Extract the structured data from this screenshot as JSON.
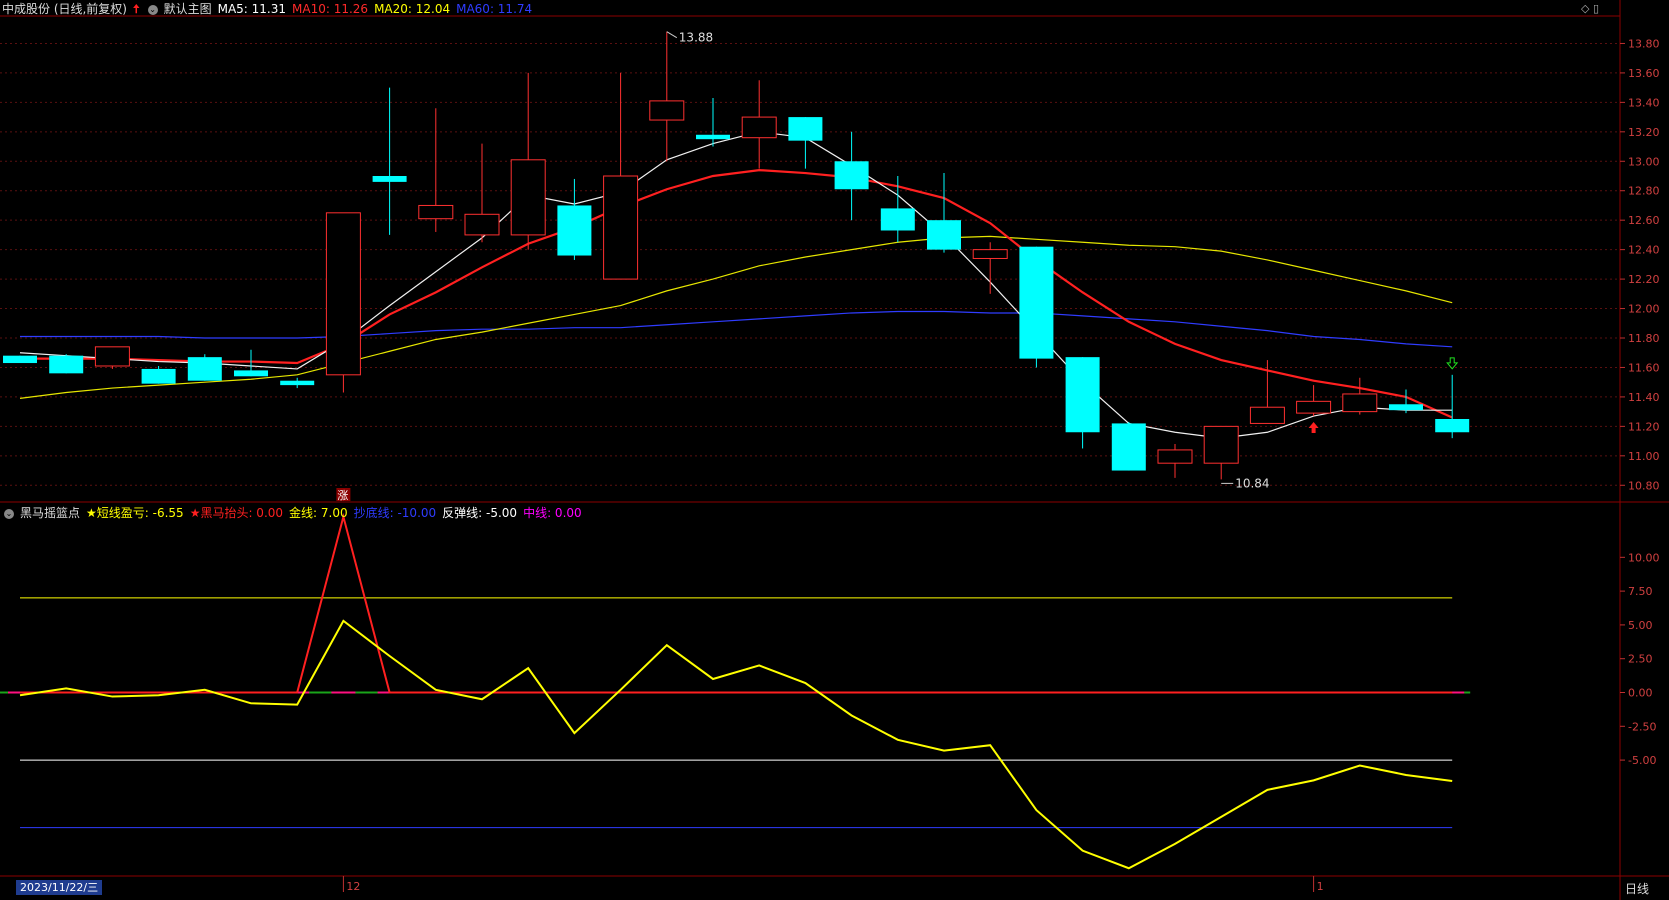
{
  "upper_header": {
    "stock": "中成股份 (日线,前复权)",
    "up_arrow_icon": "red-up-arrow-icon",
    "template": "默认主图",
    "ma_items": [
      {
        "label": "MA5: 11.31",
        "color": "#ffffff"
      },
      {
        "label": "MA10: 11.26",
        "color": "#ff2a2a"
      },
      {
        "label": "MA20: 12.04",
        "color": "#ffff00"
      },
      {
        "label": "MA60: 11.74",
        "color": "#2f3cff"
      }
    ]
  },
  "lower_header": {
    "title": "黑马摇篮点",
    "items": [
      {
        "label": "★短线盈亏: -6.55",
        "color": "#ffff00"
      },
      {
        "label": "★黑马抬头: 0.00",
        "color": "#ff2020"
      },
      {
        "label": "金线: 7.00",
        "color": "#ffff00"
      },
      {
        "label": "抄底线: -10.00",
        "color": "#2f3cff"
      },
      {
        "label": "反弹线: -5.00",
        "color": "#ffffff"
      },
      {
        "label": "中线: 0.00",
        "color": "#ff00ff"
      }
    ]
  },
  "annotations": {
    "high": "13.88",
    "low": "10.84",
    "zhang": "涨"
  },
  "footer": {
    "date": "2023/11/22/三",
    "period": "日线",
    "x_labels": [
      {
        "label": "12",
        "index": 7
      },
      {
        "label": "1",
        "index": 28
      }
    ]
  },
  "chart_data": [
    {
      "type": "candlestick",
      "ylim": [
        10.7,
        14.0
      ],
      "yticks": [
        "10.80",
        "11.00",
        "11.20",
        "11.40",
        "11.60",
        "11.80",
        "12.00",
        "12.20",
        "12.40",
        "12.60",
        "12.80",
        "13.00",
        "13.20",
        "13.40",
        "13.60",
        "13.80"
      ],
      "ohlc": [
        {
          "o": 11.68,
          "h": 11.68,
          "l": 11.63,
          "c": 11.63
        },
        {
          "o": 11.68,
          "h": 11.69,
          "l": 11.56,
          "c": 11.56
        },
        {
          "o": 11.61,
          "h": 11.74,
          "l": 11.59,
          "c": 11.74
        },
        {
          "o": 11.59,
          "h": 11.61,
          "l": 11.49,
          "c": 11.49
        },
        {
          "o": 11.67,
          "h": 11.69,
          "l": 11.51,
          "c": 11.51
        },
        {
          "o": 11.58,
          "h": 11.72,
          "l": 11.54,
          "c": 11.54
        },
        {
          "o": 11.51,
          "h": 11.53,
          "l": 11.46,
          "c": 11.48
        },
        {
          "o": 11.55,
          "h": 12.65,
          "l": 11.43,
          "c": 12.65
        },
        {
          "o": 12.9,
          "h": 13.5,
          "l": 12.5,
          "c": 12.86
        },
        {
          "o": 12.61,
          "h": 13.36,
          "l": 12.52,
          "c": 12.7
        },
        {
          "o": 12.5,
          "h": 13.12,
          "l": 12.45,
          "c": 12.64
        },
        {
          "o": 12.5,
          "h": 13.6,
          "l": 12.4,
          "c": 13.01
        },
        {
          "o": 12.7,
          "h": 12.88,
          "l": 12.33,
          "c": 12.36
        },
        {
          "o": 12.2,
          "h": 13.6,
          "l": 12.2,
          "c": 12.9
        },
        {
          "o": 13.28,
          "h": 13.88,
          "l": 13.0,
          "c": 13.41
        },
        {
          "o": 13.18,
          "h": 13.43,
          "l": 13.1,
          "c": 13.15
        },
        {
          "o": 13.16,
          "h": 13.55,
          "l": 12.95,
          "c": 13.3
        },
        {
          "o": 13.3,
          "h": 13.3,
          "l": 12.95,
          "c": 13.14
        },
        {
          "o": 13.0,
          "h": 13.2,
          "l": 12.6,
          "c": 12.81
        },
        {
          "o": 12.68,
          "h": 12.9,
          "l": 12.45,
          "c": 12.53
        },
        {
          "o": 12.6,
          "h": 12.92,
          "l": 12.38,
          "c": 12.4
        },
        {
          "o": 12.34,
          "h": 12.45,
          "l": 12.1,
          "c": 12.4
        },
        {
          "o": 12.42,
          "h": 12.42,
          "l": 11.6,
          "c": 11.66
        },
        {
          "o": 11.67,
          "h": 11.67,
          "l": 11.05,
          "c": 11.16
        },
        {
          "o": 11.22,
          "h": 11.23,
          "l": 10.9,
          "c": 10.9
        },
        {
          "o": 10.95,
          "h": 11.08,
          "l": 10.85,
          "c": 11.04
        },
        {
          "o": 10.95,
          "h": 11.2,
          "l": 10.84,
          "c": 11.2
        },
        {
          "o": 11.22,
          "h": 11.65,
          "l": 11.22,
          "c": 11.33
        },
        {
          "o": 11.29,
          "h": 11.48,
          "l": 11.27,
          "c": 11.37
        },
        {
          "o": 11.3,
          "h": 11.53,
          "l": 11.28,
          "c": 11.42
        },
        {
          "o": 11.35,
          "h": 11.45,
          "l": 11.29,
          "c": 11.31
        },
        {
          "o": 11.25,
          "h": 11.55,
          "l": 11.12,
          "c": 11.16
        }
      ],
      "ma5": [
        11.7,
        11.68,
        11.66,
        11.64,
        11.63,
        11.61,
        11.59,
        11.78,
        12.02,
        12.25,
        12.48,
        12.77,
        12.71,
        12.79,
        13.01,
        13.12,
        13.2,
        13.16,
        12.97,
        12.77,
        12.5,
        12.18,
        11.84,
        11.5,
        11.22,
        11.16,
        11.12,
        11.16,
        11.27,
        11.33,
        11.31,
        11.31
      ],
      "ma10": [
        11.66,
        11.66,
        11.66,
        11.65,
        11.64,
        11.64,
        11.63,
        11.76,
        11.96,
        12.11,
        12.28,
        12.44,
        12.55,
        12.69,
        12.81,
        12.9,
        12.94,
        12.92,
        12.89,
        12.83,
        12.75,
        12.58,
        12.33,
        12.11,
        11.91,
        11.76,
        11.65,
        11.58,
        11.51,
        11.46,
        11.4,
        11.26
      ],
      "ma20": [
        11.39,
        11.43,
        11.46,
        11.48,
        11.5,
        11.52,
        11.55,
        11.63,
        11.71,
        11.79,
        11.84,
        11.9,
        11.96,
        12.02,
        12.12,
        12.2,
        12.29,
        12.35,
        12.4,
        12.45,
        12.48,
        12.49,
        12.47,
        12.45,
        12.43,
        12.42,
        12.39,
        12.33,
        12.26,
        12.19,
        12.12,
        12.04
      ],
      "ma60": [
        11.81,
        11.81,
        11.81,
        11.81,
        11.8,
        11.8,
        11.8,
        11.81,
        11.83,
        11.85,
        11.86,
        11.86,
        11.87,
        11.87,
        11.89,
        11.91,
        11.93,
        11.95,
        11.97,
        11.98,
        11.98,
        11.97,
        11.97,
        11.95,
        11.93,
        11.91,
        11.88,
        11.85,
        11.81,
        11.79,
        11.76,
        11.74
      ]
    },
    {
      "type": "line",
      "ylim": [
        -13.5,
        13.5
      ],
      "yticks": [
        "10.00",
        "7.50",
        "5.00",
        "2.50",
        "0.00",
        "-2.50",
        "-5.00"
      ],
      "series": [
        {
          "name": "★短线盈亏",
          "color": "#ffff00",
          "values": [
            -0.2,
            0.3,
            -0.3,
            -0.2,
            0.2,
            -0.8,
            -0.9,
            5.3,
            2.7,
            0.2,
            -0.5,
            1.8,
            -3.0,
            0.2,
            3.5,
            1.0,
            2.0,
            0.7,
            -1.7,
            -3.5,
            -4.3,
            -3.9,
            -8.7,
            -11.7,
            -13.0,
            -11.2,
            -9.2,
            -7.2,
            -6.5,
            -5.4,
            -6.1,
            -6.55
          ]
        },
        {
          "name": "★黑马抬头",
          "color": "#ff2020",
          "values": [
            0,
            0,
            0,
            0,
            0,
            0,
            0,
            13.0,
            0,
            0,
            0,
            0,
            0,
            0,
            0,
            0,
            0,
            0,
            0,
            0,
            0,
            0,
            0,
            0,
            0,
            0,
            0,
            0,
            0,
            0,
            0,
            0
          ]
        }
      ],
      "hlines": [
        {
          "name": "金线",
          "value": 7.0,
          "color": "#ffff00"
        },
        {
          "name": "反弹线",
          "value": -5.0,
          "color": "#ffffff"
        },
        {
          "name": "抄底线",
          "value": -10.0,
          "color": "#2f3cff"
        }
      ]
    }
  ]
}
